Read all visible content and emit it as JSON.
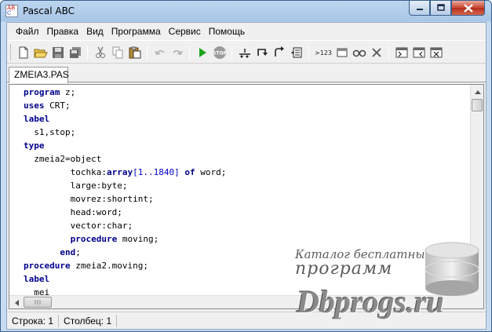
{
  "window": {
    "title": "Pascal ABC",
    "icon_text_top": "AB",
    "icon_text_bottom": "C"
  },
  "window_controls": {
    "minimize_icon": "minimize-icon",
    "maximize_icon": "maximize-icon",
    "close_icon": "close-icon"
  },
  "menu": {
    "items": [
      "Файл",
      "Правка",
      "Вид",
      "Программа",
      "Сервис",
      "Помощь"
    ]
  },
  "toolbar": {
    "buttons": [
      {
        "name": "new-file-icon"
      },
      {
        "name": "open-folder-icon"
      },
      {
        "name": "save-icon"
      },
      {
        "name": "save-all-icon"
      },
      {
        "name": "cut-icon"
      },
      {
        "name": "copy-icon"
      },
      {
        "name": "paste-icon"
      },
      {
        "name": "undo-icon"
      },
      {
        "name": "redo-icon"
      },
      {
        "name": "run-icon"
      },
      {
        "name": "stop-icon",
        "label": "STOP"
      },
      {
        "name": "step-into-icon"
      },
      {
        "name": "step-over-icon"
      },
      {
        "name": "step-out-icon"
      },
      {
        "name": "debug-window-icon"
      },
      {
        "name": "evaluate-icon",
        "label": ">123"
      },
      {
        "name": "window-icon"
      },
      {
        "name": "watch-icon"
      },
      {
        "name": "clear-icon"
      },
      {
        "name": "dock-left-icon"
      },
      {
        "name": "dock-right-icon"
      },
      {
        "name": "dock-close-icon"
      }
    ]
  },
  "tabs": [
    {
      "label": "ZMEIA3.PAS",
      "active": true
    }
  ],
  "editor": {
    "lines": [
      [
        {
          "t": "program",
          "k": 1
        },
        {
          "t": " z;"
        }
      ],
      [
        {
          "t": "uses",
          "k": 1
        },
        {
          "t": " CRT;"
        }
      ],
      [
        {
          "t": "label",
          "k": 1
        }
      ],
      [
        {
          "t": "  s1,stop;"
        }
      ],
      [
        {
          "t": "type",
          "k": 1
        }
      ],
      [
        {
          "t": "  zmeia2=object"
        }
      ],
      [
        {
          "t": "         tochka:"
        },
        {
          "t": "array",
          "k": 1
        },
        {
          "t": "[1..1840]",
          "n": 1
        },
        {
          "t": " "
        },
        {
          "t": "of",
          "k": 1
        },
        {
          "t": " word;"
        }
      ],
      [
        {
          "t": "         large:byte;"
        }
      ],
      [
        {
          "t": "         movrez:shortint;"
        }
      ],
      [
        {
          "t": "         head:word;"
        }
      ],
      [
        {
          "t": "         vector:char;"
        }
      ],
      [
        {
          "t": "         "
        },
        {
          "t": "procedure",
          "k": 1
        },
        {
          "t": " moving;"
        }
      ],
      [
        {
          "t": "       "
        },
        {
          "t": "end",
          "k": 1
        },
        {
          "t": ";"
        }
      ],
      [
        {
          "t": "procedure",
          "k": 1
        },
        {
          "t": " zmeia2.moving;"
        }
      ],
      [
        {
          "t": "label",
          "k": 1
        }
      ],
      [
        {
          "t": "  mei"
        }
      ]
    ]
  },
  "statusbar": {
    "row": "Строка: 1",
    "col": "Столбец: 1"
  },
  "watermark": {
    "line1": "Каталог бесплатных",
    "line2": "программ",
    "line3": "Dbprogs.ru"
  },
  "colors": {
    "keyword": "#00008b",
    "run_green": "#1aa51a",
    "titlebar": "#bcd6ef"
  }
}
